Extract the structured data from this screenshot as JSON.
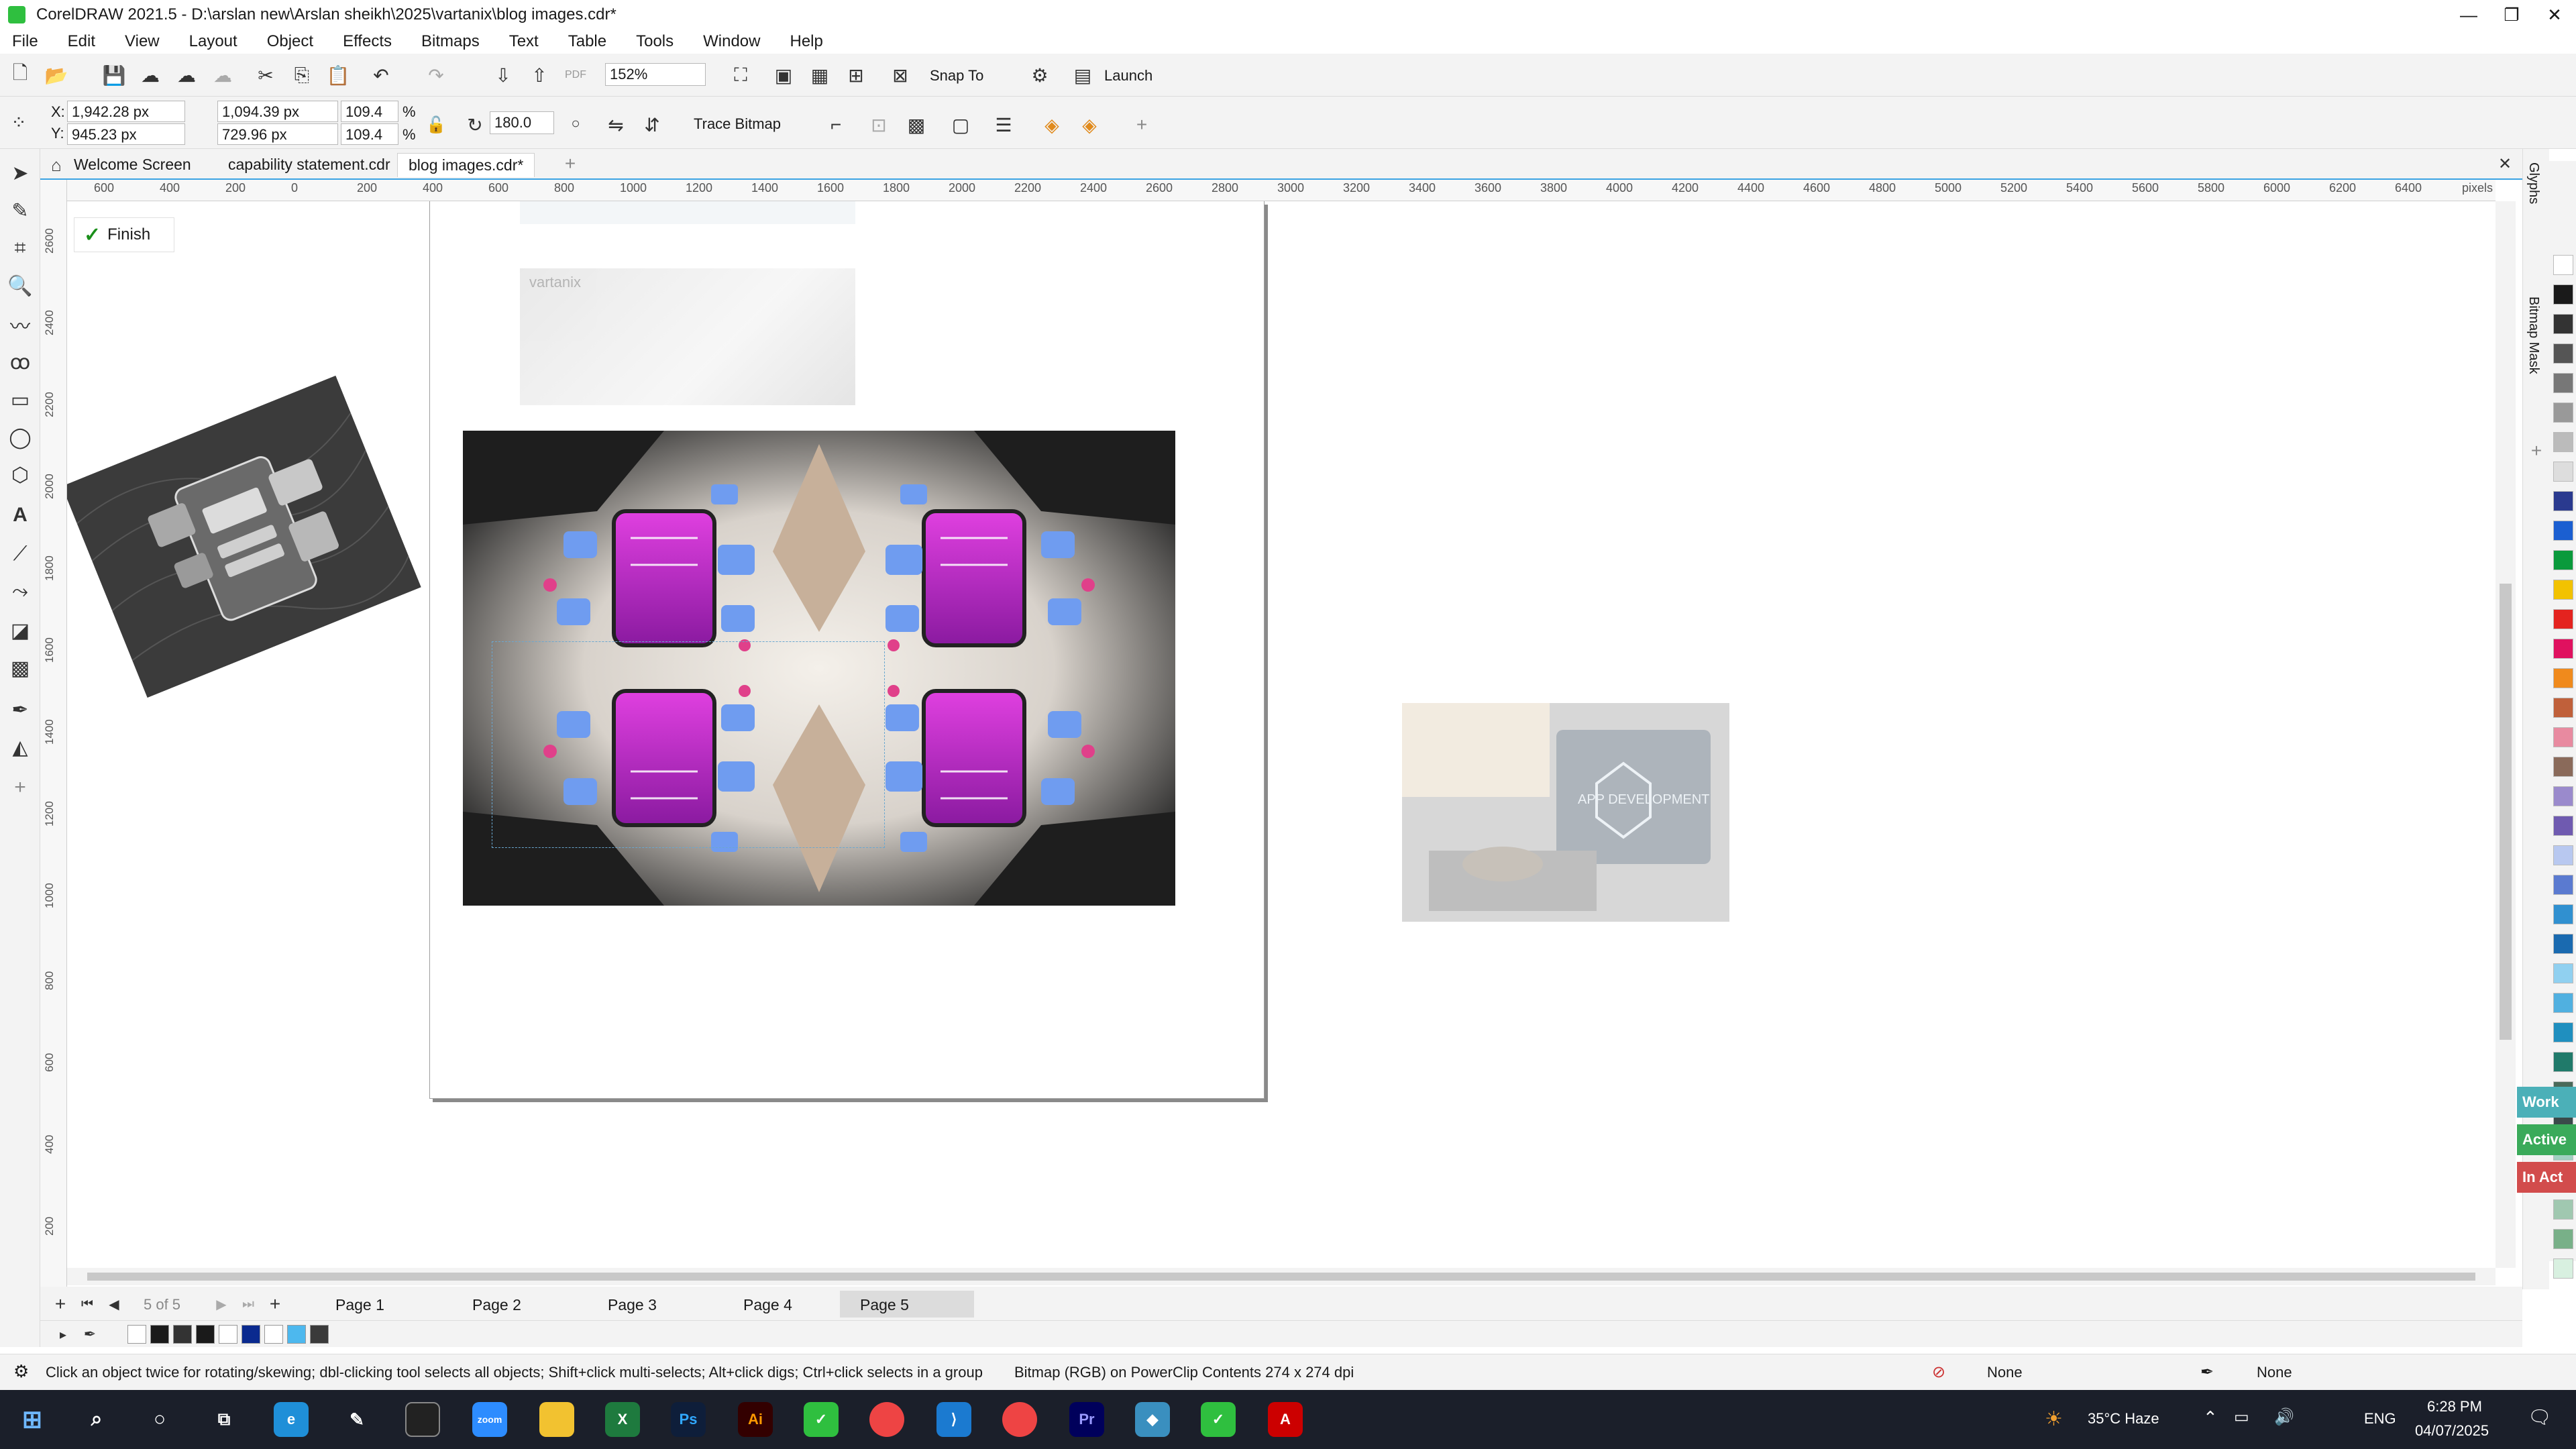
{
  "window": {
    "title": "CorelDRAW 2021.5 - D:\\arslan new\\Arslan sheikh\\2025\\vartanix\\blog images.cdr*",
    "controls": [
      "—",
      "❐",
      "✕"
    ]
  },
  "menu": [
    "File",
    "Edit",
    "View",
    "Layout",
    "Object",
    "Effects",
    "Bitmaps",
    "Text",
    "Table",
    "Tools",
    "Window",
    "Help"
  ],
  "toolbar": {
    "zoom": "152%",
    "snap_to": "Snap To",
    "launch": "Launch"
  },
  "properties": {
    "x": "1,942.28 px",
    "y": "945.23 px",
    "width": "1,094.39 px",
    "height": "729.96 px",
    "scale_w": "109.4",
    "scale_h": "109.4",
    "percent": "%",
    "rotation": "180.0",
    "trace_bitmap": "Trace Bitmap"
  },
  "tabs": [
    {
      "label": "Welcome Screen"
    },
    {
      "label": "capability statement.cdr"
    },
    {
      "label": "blog images.cdr*"
    }
  ],
  "ruler": {
    "h_ticks": [
      "600",
      "400",
      "200",
      "0",
      "200",
      "400",
      "600",
      "800",
      "1000",
      "1200",
      "1400",
      "1600",
      "1800",
      "2000",
      "2200",
      "2400",
      "2600",
      "2800",
      "3000",
      "3200",
      "3400",
      "3600",
      "3800",
      "4000",
      "4200",
      "4400",
      "4600",
      "4800",
      "5000",
      "5200",
      "5400",
      "5600",
      "5800",
      "6000",
      "6200",
      "6400"
    ],
    "unit": "pixels",
    "v_ticks": [
      "2600",
      "2400",
      "2200",
      "2000",
      "1800",
      "1600",
      "1400",
      "1200",
      "1000",
      "800",
      "600",
      "400",
      "200",
      "pixels"
    ]
  },
  "canvas": {
    "finish_label": "Finish",
    "ghost_logo": "vartanix",
    "screen_text": "APP DEVELOPMENT"
  },
  "dockers": [
    "Glyphs",
    "Bitmap Mask"
  ],
  "status_chips": [
    {
      "label": "Work",
      "color": "#4bb0b8"
    },
    {
      "label": "Active",
      "color": "#3aaa5a"
    },
    {
      "label": "In Act",
      "color": "#d24c4c"
    }
  ],
  "pages": {
    "counter": "5 of 5",
    "list": [
      "Page 1",
      "Page 2",
      "Page 3",
      "Page 4",
      "Page 5"
    ],
    "active": "Page 5"
  },
  "status": {
    "hint": "Click an object twice for rotating/skewing; dbl-clicking tool selects all objects; Shift+click multi-selects; Alt+click digs; Ctrl+click selects in a group",
    "object": "Bitmap (RGB) on PowerClip Contents 274 x 274 dpi",
    "fill": "None",
    "outline": "None"
  },
  "taskbar": {
    "weather": "35°C Haze",
    "lang": "ENG",
    "time": "6:28 PM",
    "date": "04/07/2025",
    "apps": [
      "Ps",
      "Ai",
      "Pr"
    ]
  },
  "palette_colors": [
    "#ffffff",
    "#1a1a1a",
    "#333333",
    "#555555",
    "#777777",
    "#999999",
    "#bbbbbb",
    "#dddddd",
    "#2a3a8f",
    "#1b5fd1",
    "#0a9a3c",
    "#f2c200",
    "#e4231f",
    "#e0115f",
    "#f08a1c",
    "#c0603a",
    "#e88aa0",
    "#8a6a5a",
    "#9a8acc",
    "#6f5ab0",
    "#b8c8f0",
    "#5a7ad0",
    "#3090d0",
    "#1a6ab0",
    "#90d0f0",
    "#50b0e0",
    "#1f8fbf",
    "#207a6a",
    "#4a6a5a",
    "#3a4a4a",
    "#a0d0c0",
    "#c8e8d8",
    "#a0c8b0",
    "#78b088",
    "#d8f0e0"
  ],
  "doc_palette": [
    "#ffffff",
    "#1a1a1a",
    "#333333",
    "#1a1a1a",
    "#ffffff",
    "#0a2a8f",
    "#ffffff",
    "#4db8ee",
    "#3a3a3a"
  ]
}
